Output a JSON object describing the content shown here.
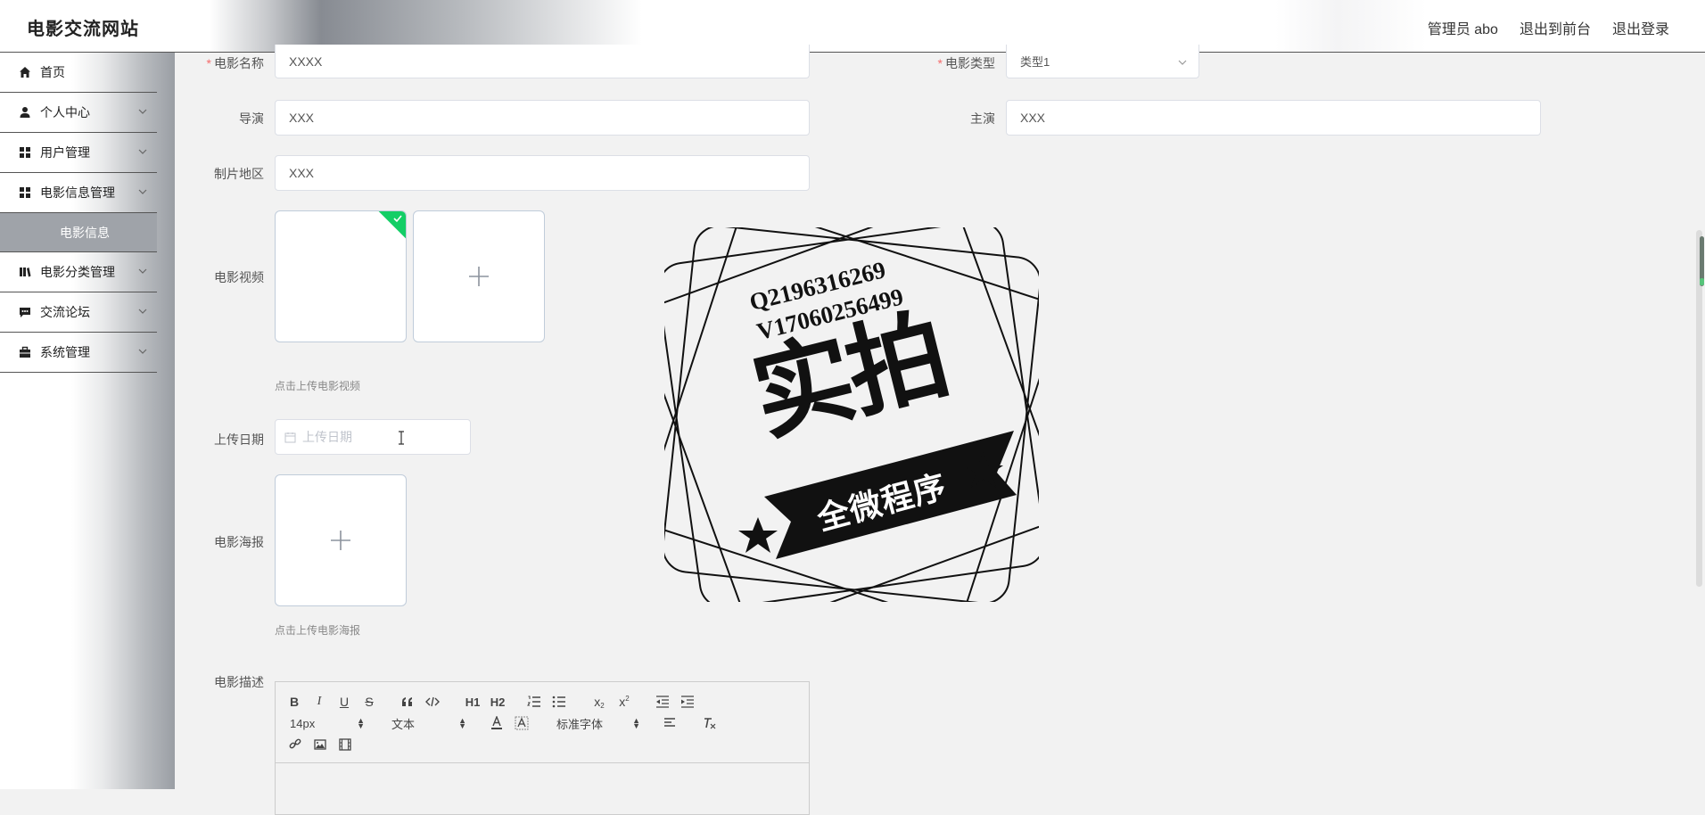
{
  "header": {
    "site_title": "电影交流网站",
    "user_label": "管理员 abo",
    "back_to_front": "退出到前台",
    "logout": "退出登录"
  },
  "sidebar": {
    "items": [
      {
        "label": "首页",
        "icon": "home-icon"
      },
      {
        "label": "个人中心",
        "icon": "user-icon"
      },
      {
        "label": "用户管理",
        "icon": "grid-icon"
      },
      {
        "label": "电影信息管理",
        "icon": "grid-icon"
      },
      {
        "label": "电影分类管理",
        "icon": "book-icon"
      },
      {
        "label": "交流论坛",
        "icon": "chat-icon"
      },
      {
        "label": "系统管理",
        "icon": "briefcase-icon"
      }
    ],
    "active_sub": "电影信息"
  },
  "form": {
    "movie_name": {
      "label": "电影名称",
      "value": "XXXX"
    },
    "movie_type": {
      "label": "电影类型",
      "value": "类型1"
    },
    "director": {
      "label": "导演",
      "value": "XXX"
    },
    "actor": {
      "label": "主演",
      "value": "XXX"
    },
    "region": {
      "label": "制片地区",
      "value": "XXX"
    },
    "video": {
      "label": "电影视频",
      "hint": "点击上传电影视频"
    },
    "upload_date": {
      "label": "上传日期",
      "placeholder": "上传日期"
    },
    "poster": {
      "label": "电影海报",
      "hint": "点击上传电影海报"
    },
    "description": {
      "label": "电影描述"
    }
  },
  "editor": {
    "font_size": "14px",
    "text_style": "文本",
    "font_family": "标准字体",
    "h1": "H1",
    "h2": "H2"
  },
  "watermark": {
    "line1": "Q2196316269",
    "line2": "V17060256499",
    "main": "实拍",
    "banner": "全微程序"
  }
}
